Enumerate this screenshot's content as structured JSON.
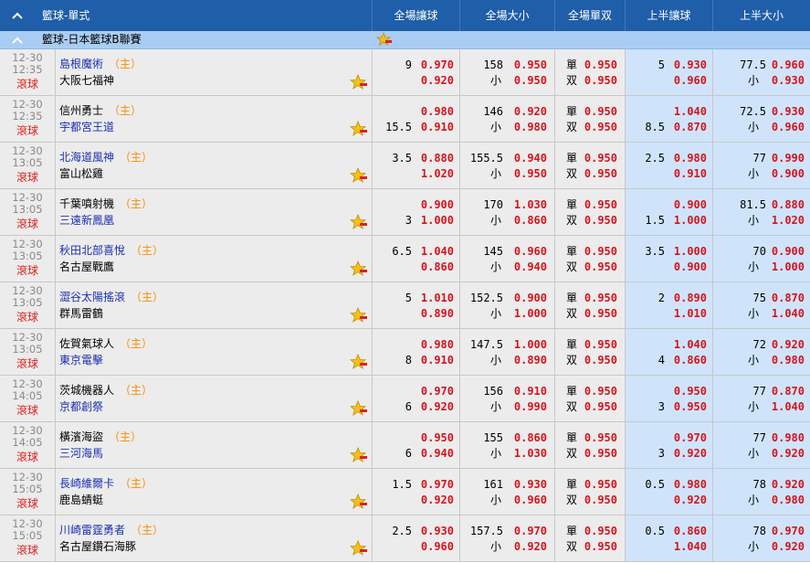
{
  "header": {
    "section_title": "籃球-單式",
    "columns": [
      "全場讓球",
      "全場大小",
      "全場單双",
      "上半讓球",
      "上半大小"
    ]
  },
  "league": {
    "name": "籃球-日本籃球B聯賽"
  },
  "labels": {
    "under": "小",
    "odd": "單",
    "even": "双",
    "home_tag": "（主）"
  },
  "icons": {
    "collapse": "chevron-up-icon",
    "favorite": "star-add-icon"
  },
  "colors": {
    "header": "#1f5ea8",
    "league_bar": "#a9cdf2",
    "odds": "#d5141c",
    "live": "#e0201a",
    "fav_team": "#1a2fb0",
    "home_tag": "#ff8a00",
    "half_cols": "#cfe4fb"
  },
  "matches": [
    {
      "date": "12-30",
      "time": "12:35",
      "status": "滾球",
      "team1": "島根魔術",
      "team2": "大阪七福神",
      "fav": 1,
      "fh": {
        "line1": "9",
        "o1": "0.970",
        "line2": "",
        "o2": "0.920"
      },
      "fou": {
        "line": "158",
        "over": "0.950",
        "under": "0.950"
      },
      "oe": {
        "odd": "0.950",
        "even": "0.950"
      },
      "hh": {
        "line1": "5",
        "o1": "0.930",
        "line2": "",
        "o2": "0.960"
      },
      "hou": {
        "line": "77.5",
        "over": "0.960",
        "under": "0.930"
      }
    },
    {
      "date": "12-30",
      "time": "12:35",
      "status": "滾球",
      "team1": "信州勇士",
      "team2": "宇都宮王道",
      "fav": 2,
      "fh": {
        "line1": "",
        "o1": "0.980",
        "line2": "15.5",
        "o2": "0.910"
      },
      "fou": {
        "line": "146",
        "over": "0.920",
        "under": "0.980"
      },
      "oe": {
        "odd": "0.950",
        "even": "0.950"
      },
      "hh": {
        "line1": "",
        "o1": "1.040",
        "line2": "8.5",
        "o2": "0.870"
      },
      "hou": {
        "line": "72.5",
        "over": "0.930",
        "under": "0.960"
      }
    },
    {
      "date": "12-30",
      "time": "13:05",
      "status": "滾球",
      "team1": "北海道風神",
      "team2": "富山松雞",
      "fav": 1,
      "fh": {
        "line1": "3.5",
        "o1": "0.880",
        "line2": "",
        "o2": "1.020"
      },
      "fou": {
        "line": "155.5",
        "over": "0.940",
        "under": "0.950"
      },
      "oe": {
        "odd": "0.950",
        "even": "0.950"
      },
      "hh": {
        "line1": "2.5",
        "o1": "0.980",
        "line2": "",
        "o2": "0.910"
      },
      "hou": {
        "line": "77",
        "over": "0.990",
        "under": "0.900"
      }
    },
    {
      "date": "12-30",
      "time": "13:05",
      "status": "滾球",
      "team1": "千葉噴射機",
      "team2": "三遠新鳳凰",
      "fav": 2,
      "fh": {
        "line1": "",
        "o1": "0.900",
        "line2": "3",
        "o2": "1.000"
      },
      "fou": {
        "line": "170",
        "over": "1.030",
        "under": "0.860"
      },
      "oe": {
        "odd": "0.950",
        "even": "0.950"
      },
      "hh": {
        "line1": "",
        "o1": "0.900",
        "line2": "1.5",
        "o2": "1.000"
      },
      "hou": {
        "line": "81.5",
        "over": "0.880",
        "under": "1.020"
      }
    },
    {
      "date": "12-30",
      "time": "13:05",
      "status": "滾球",
      "team1": "秋田北部喜悅",
      "team2": "名古屋戰鷹",
      "fav": 1,
      "fh": {
        "line1": "6.5",
        "o1": "1.040",
        "line2": "",
        "o2": "0.860"
      },
      "fou": {
        "line": "145",
        "over": "0.960",
        "under": "0.940"
      },
      "oe": {
        "odd": "0.950",
        "even": "0.950"
      },
      "hh": {
        "line1": "3.5",
        "o1": "1.000",
        "line2": "",
        "o2": "0.900"
      },
      "hou": {
        "line": "70",
        "over": "0.900",
        "under": "1.000"
      }
    },
    {
      "date": "12-30",
      "time": "13:05",
      "status": "滾球",
      "team1": "澀谷太陽搖滾",
      "team2": "群馬雷鶴",
      "fav": 1,
      "fh": {
        "line1": "5",
        "o1": "1.010",
        "line2": "",
        "o2": "0.890"
      },
      "fou": {
        "line": "152.5",
        "over": "0.900",
        "under": "1.000"
      },
      "oe": {
        "odd": "0.950",
        "even": "0.950"
      },
      "hh": {
        "line1": "2",
        "o1": "0.890",
        "line2": "",
        "o2": "1.010"
      },
      "hou": {
        "line": "75",
        "over": "0.870",
        "under": "1.040"
      }
    },
    {
      "date": "12-30",
      "time": "13:05",
      "status": "滾球",
      "team1": "佐賀氣球人",
      "team2": "東京電擊",
      "fav": 2,
      "fh": {
        "line1": "",
        "o1": "0.980",
        "line2": "8",
        "o2": "0.910"
      },
      "fou": {
        "line": "147.5",
        "over": "1.000",
        "under": "0.890"
      },
      "oe": {
        "odd": "0.950",
        "even": "0.950"
      },
      "hh": {
        "line1": "",
        "o1": "1.040",
        "line2": "4",
        "o2": "0.860"
      },
      "hou": {
        "line": "72",
        "over": "0.920",
        "under": "0.980"
      }
    },
    {
      "date": "12-30",
      "time": "14:05",
      "status": "滾球",
      "team1": "茨城機器人",
      "team2": "京都創祭",
      "fav": 2,
      "fh": {
        "line1": "",
        "o1": "0.970",
        "line2": "6",
        "o2": "0.920"
      },
      "fou": {
        "line": "156",
        "over": "0.910",
        "under": "0.990"
      },
      "oe": {
        "odd": "0.950",
        "even": "0.950"
      },
      "hh": {
        "line1": "",
        "o1": "0.950",
        "line2": "3",
        "o2": "0.950"
      },
      "hou": {
        "line": "77",
        "over": "0.870",
        "under": "1.040"
      }
    },
    {
      "date": "12-30",
      "time": "14:05",
      "status": "滾球",
      "team1": "橫濱海盜",
      "team2": "三河海馬",
      "fav": 2,
      "fh": {
        "line1": "",
        "o1": "0.950",
        "line2": "6",
        "o2": "0.940"
      },
      "fou": {
        "line": "155",
        "over": "0.860",
        "under": "1.030"
      },
      "oe": {
        "odd": "0.950",
        "even": "0.950"
      },
      "hh": {
        "line1": "",
        "o1": "0.970",
        "line2": "3",
        "o2": "0.920"
      },
      "hou": {
        "line": "77",
        "over": "0.980",
        "under": "0.920"
      }
    },
    {
      "date": "12-30",
      "time": "15:05",
      "status": "滾球",
      "team1": "長崎維爾卡",
      "team2": "鹿島蜻蜓",
      "fav": 1,
      "fh": {
        "line1": "1.5",
        "o1": "0.970",
        "line2": "",
        "o2": "0.920"
      },
      "fou": {
        "line": "161",
        "over": "0.930",
        "under": "0.960"
      },
      "oe": {
        "odd": "0.950",
        "even": "0.950"
      },
      "hh": {
        "line1": "0.5",
        "o1": "0.980",
        "line2": "",
        "o2": "0.920"
      },
      "hou": {
        "line": "78",
        "over": "0.920",
        "under": "0.980"
      }
    },
    {
      "date": "12-30",
      "time": "15:05",
      "status": "滾球",
      "team1": "川崎雷霆勇者",
      "team2": "名古屋鑽石海豚",
      "fav": 1,
      "fh": {
        "line1": "2.5",
        "o1": "0.930",
        "line2": "",
        "o2": "0.960"
      },
      "fou": {
        "line": "157.5",
        "over": "0.970",
        "under": "0.920"
      },
      "oe": {
        "odd": "0.950",
        "even": "0.950"
      },
      "hh": {
        "line1": "0.5",
        "o1": "0.860",
        "line2": "",
        "o2": "1.040"
      },
      "hou": {
        "line": "78",
        "over": "0.970",
        "under": "0.920"
      }
    }
  ]
}
